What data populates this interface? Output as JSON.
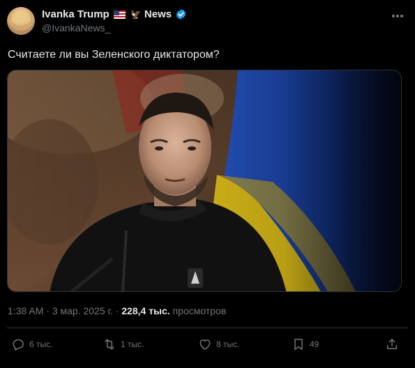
{
  "author": {
    "display_name": "Ivanka Trump",
    "name_suffix": "News",
    "handle": "@IvankaNews_",
    "flag_icon": "us-flag-icon",
    "emoji_icon": "eagle-icon",
    "verified_color": "#1d9bf0"
  },
  "tweet": {
    "text": "Считаете ли вы Зеленского диктатором?"
  },
  "meta": {
    "time": "1:38 AM",
    "separator1": "·",
    "date": "3 мар. 2025 г.",
    "separator2": "·",
    "views_count": "228,4 тыс.",
    "views_label": "просмотров"
  },
  "actions": {
    "replies": "6 тыс.",
    "retweets": "1 тыс.",
    "likes": "8 тыс.",
    "bookmarks": "49"
  },
  "colors": {
    "background": "#000000",
    "text": "#e7e9ea",
    "muted": "#71767b",
    "divider": "#2f3336",
    "flag_blue": "#1f5bd6",
    "flag_yellow": "#f6d31b"
  }
}
